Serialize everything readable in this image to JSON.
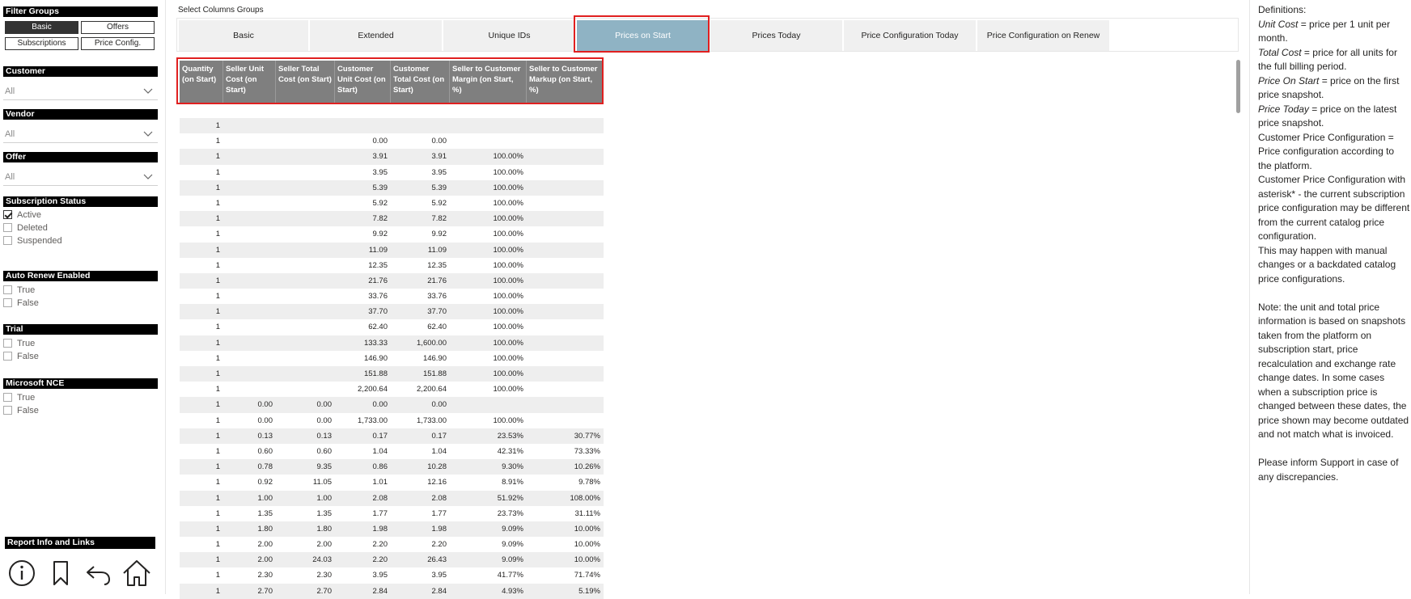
{
  "filters": {
    "filter_groups_label": "Filter Groups",
    "group_buttons": [
      "Basic",
      "Offers",
      "Subscriptions",
      "Price Config."
    ],
    "selected_group": "Basic",
    "customer": {
      "label": "Customer",
      "value": "All"
    },
    "vendor": {
      "label": "Vendor",
      "value": "All"
    },
    "offer": {
      "label": "Offer",
      "value": "All"
    },
    "subscription_status": {
      "label": "Subscription Status",
      "options": [
        {
          "label": "Active",
          "checked": true
        },
        {
          "label": "Deleted",
          "checked": false
        },
        {
          "label": "Suspended",
          "checked": false
        }
      ]
    },
    "auto_renew": {
      "label": "Auto Renew Enabled",
      "options": [
        {
          "label": "True",
          "checked": false
        },
        {
          "label": "False",
          "checked": false
        }
      ]
    },
    "trial": {
      "label": "Trial",
      "options": [
        {
          "label": "True",
          "checked": false
        },
        {
          "label": "False",
          "checked": false
        }
      ]
    },
    "microsoft_nce": {
      "label": "Microsoft NCE",
      "options": [
        {
          "label": "True",
          "checked": false
        },
        {
          "label": "False",
          "checked": false
        }
      ]
    },
    "report_info_label": "Report Info and Links",
    "nav_icons": [
      "info-icon",
      "bookmark-icon",
      "back-icon",
      "home-icon"
    ]
  },
  "tabs": {
    "caption": "Select Columns Groups",
    "items": [
      "Basic",
      "Extended",
      "Unique IDs",
      "Prices on Start",
      "Prices Today",
      "Price Configuration Today",
      "Price Configuration on Renew"
    ],
    "active": "Prices on Start"
  },
  "table": {
    "columns": [
      "Quantity (on Start)",
      "Seller Unit Cost (on Start)",
      "Seller Total Cost (on Start)",
      "Customer Unit Cost (on Start)",
      "Customer Total Cost (on Start)",
      "Seller to Customer Margin (on Start, %)",
      "Seller to Customer Markup (on Start, %)"
    ],
    "rows": [
      [
        "1",
        "",
        "",
        "",
        "",
        "",
        ""
      ],
      [
        "1",
        "",
        "",
        "0.00",
        "0.00",
        "",
        ""
      ],
      [
        "1",
        "",
        "",
        "3.91",
        "3.91",
        "100.00%",
        ""
      ],
      [
        "1",
        "",
        "",
        "3.95",
        "3.95",
        "100.00%",
        ""
      ],
      [
        "1",
        "",
        "",
        "5.39",
        "5.39",
        "100.00%",
        ""
      ],
      [
        "1",
        "",
        "",
        "5.92",
        "5.92",
        "100.00%",
        ""
      ],
      [
        "1",
        "",
        "",
        "7.82",
        "7.82",
        "100.00%",
        ""
      ],
      [
        "1",
        "",
        "",
        "9.92",
        "9.92",
        "100.00%",
        ""
      ],
      [
        "1",
        "",
        "",
        "11.09",
        "11.09",
        "100.00%",
        ""
      ],
      [
        "1",
        "",
        "",
        "12.35",
        "12.35",
        "100.00%",
        ""
      ],
      [
        "1",
        "",
        "",
        "21.76",
        "21.76",
        "100.00%",
        ""
      ],
      [
        "1",
        "",
        "",
        "33.76",
        "33.76",
        "100.00%",
        ""
      ],
      [
        "1",
        "",
        "",
        "37.70",
        "37.70",
        "100.00%",
        ""
      ],
      [
        "1",
        "",
        "",
        "62.40",
        "62.40",
        "100.00%",
        ""
      ],
      [
        "1",
        "",
        "",
        "133.33",
        "1,600.00",
        "100.00%",
        ""
      ],
      [
        "1",
        "",
        "",
        "146.90",
        "146.90",
        "100.00%",
        ""
      ],
      [
        "1",
        "",
        "",
        "151.88",
        "151.88",
        "100.00%",
        ""
      ],
      [
        "1",
        "",
        "",
        "2,200.64",
        "2,200.64",
        "100.00%",
        ""
      ],
      [
        "1",
        "0.00",
        "0.00",
        "0.00",
        "0.00",
        "",
        ""
      ],
      [
        "1",
        "0.00",
        "0.00",
        "1,733.00",
        "1,733.00",
        "100.00%",
        ""
      ],
      [
        "1",
        "0.13",
        "0.13",
        "0.17",
        "0.17",
        "23.53%",
        "30.77%"
      ],
      [
        "1",
        "0.60",
        "0.60",
        "1.04",
        "1.04",
        "42.31%",
        "73.33%"
      ],
      [
        "1",
        "0.78",
        "9.35",
        "0.86",
        "10.28",
        "9.30%",
        "10.26%"
      ],
      [
        "1",
        "0.92",
        "11.05",
        "1.01",
        "12.16",
        "8.91%",
        "9.78%"
      ],
      [
        "1",
        "1.00",
        "1.00",
        "2.08",
        "2.08",
        "51.92%",
        "108.00%"
      ],
      [
        "1",
        "1.35",
        "1.35",
        "1.77",
        "1.77",
        "23.73%",
        "31.11%"
      ],
      [
        "1",
        "1.80",
        "1.80",
        "1.98",
        "1.98",
        "9.09%",
        "10.00%"
      ],
      [
        "1",
        "2.00",
        "2.00",
        "2.20",
        "2.20",
        "9.09%",
        "10.00%"
      ],
      [
        "1",
        "2.00",
        "24.03",
        "2.20",
        "26.43",
        "9.09%",
        "10.00%"
      ],
      [
        "1",
        "2.30",
        "2.30",
        "3.95",
        "3.95",
        "41.77%",
        "71.74%"
      ],
      [
        "1",
        "2.70",
        "2.70",
        "2.84",
        "2.84",
        "4.93%",
        "5.19%"
      ]
    ]
  },
  "definitions": {
    "title": "Definitions:",
    "unit_cost_term": "Unit Cost",
    "unit_cost_def": " = price per 1 unit per month.",
    "total_cost_term": "Total Cost",
    "total_cost_def": " = price for all units for the full billing period.",
    "price_on_start_term": "Price On Start",
    "price_on_start_def": " = price on the first price snapshot.",
    "price_today_term": "Price Today",
    "price_today_def": " = price on the latest price snapshot.",
    "customer_price_config": "Customer Price Configuration = Price configuration according to the platform.",
    "customer_price_config_asterisk": "Customer Price Configuration with asterisk* - the current subscription price configuration may be different from the current catalog price configuration.",
    "manual_changes": "This may happen with manual changes or a backdated catalog price configurations.",
    "note": "Note: the unit and total price information is based on snapshots taken from the platform on subscription start, price recalculation and exchange rate change dates. In some cases when a subscription price is changed between these dates, the price shown may become outdated and not match what is invoiced.",
    "support": "Please inform Support in case of any discrepancies."
  }
}
